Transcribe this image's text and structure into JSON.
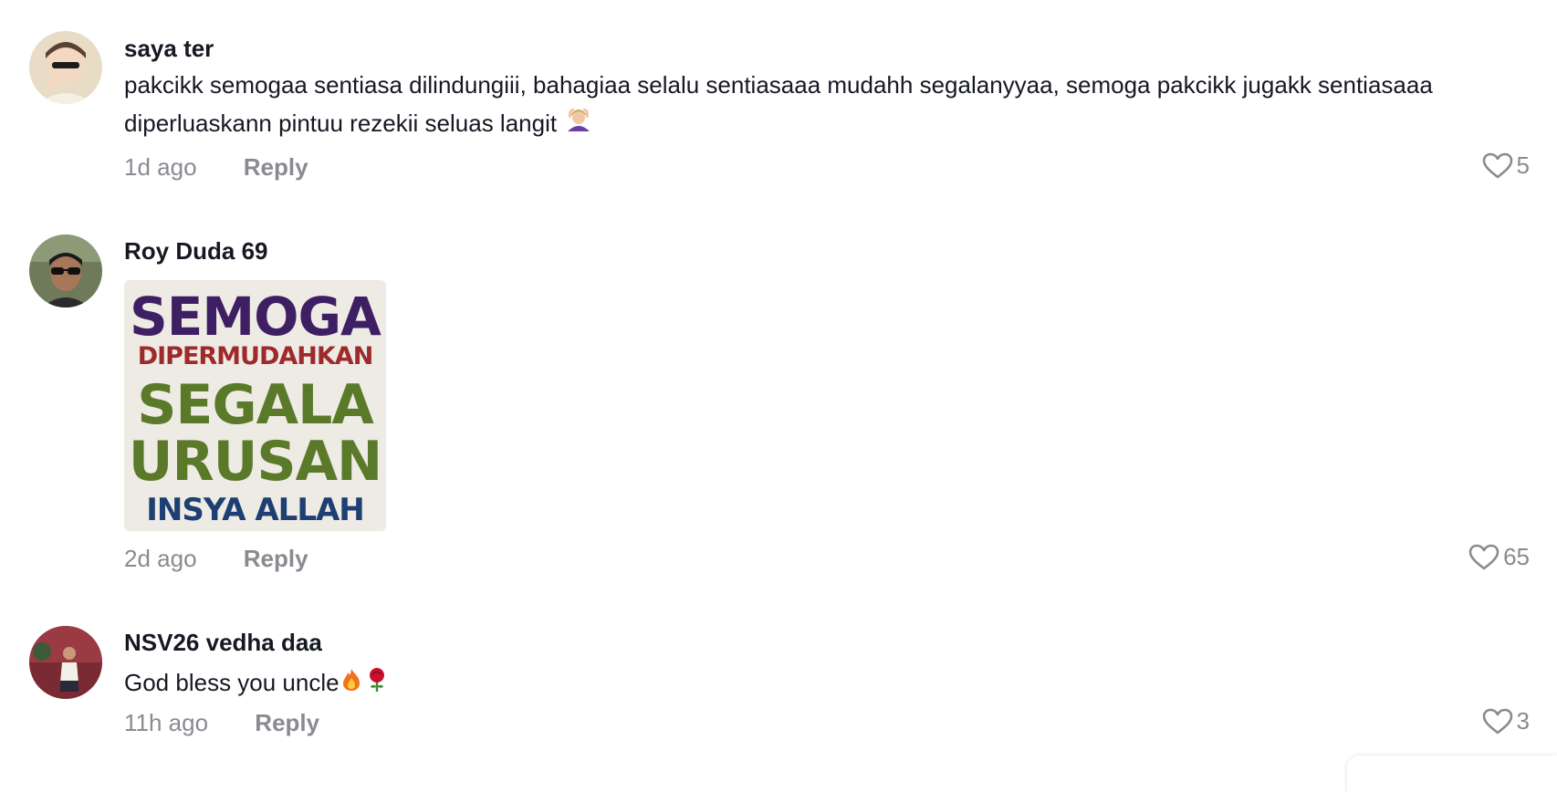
{
  "comments": [
    {
      "username": "saya ter",
      "text": "pakcikk semogaa sentiasa dilindungiii, bahagiaa selalu sentiasaaa mudahh segalanyyaa, semoga pakcikk jugakk sentiasaaa diperluaskann pintuu rezekii seluas langit",
      "emoji_icon": "person-gesturing-ok-icon",
      "time": "1d ago",
      "reply_label": "Reply",
      "likes": "5"
    },
    {
      "username": "Roy Duda 69",
      "sticker": {
        "line1": "SEMOGA",
        "line2": "DIPERMUDAHKAN",
        "line3": "SEGALA",
        "line4": "URUSAN",
        "line5": "INSYA ALLAH",
        "colors": {
          "line1": "#3e1f63",
          "line2": "#9e2a2b",
          "line3": "#5a7a2a",
          "line4": "#5a7a2a",
          "line5": "#1d3f73"
        }
      },
      "time": "2d ago",
      "reply_label": "Reply",
      "likes": "65"
    },
    {
      "username": "NSV26 vedha daa",
      "text": "God bless you uncle",
      "emoji_icons": [
        "fire-icon",
        "rose-icon"
      ],
      "time": "11h ago",
      "reply_label": "Reply",
      "likes": "3"
    }
  ],
  "colors": {
    "text": "#161823",
    "muted": "#8a8b91",
    "background": "#ffffff"
  }
}
